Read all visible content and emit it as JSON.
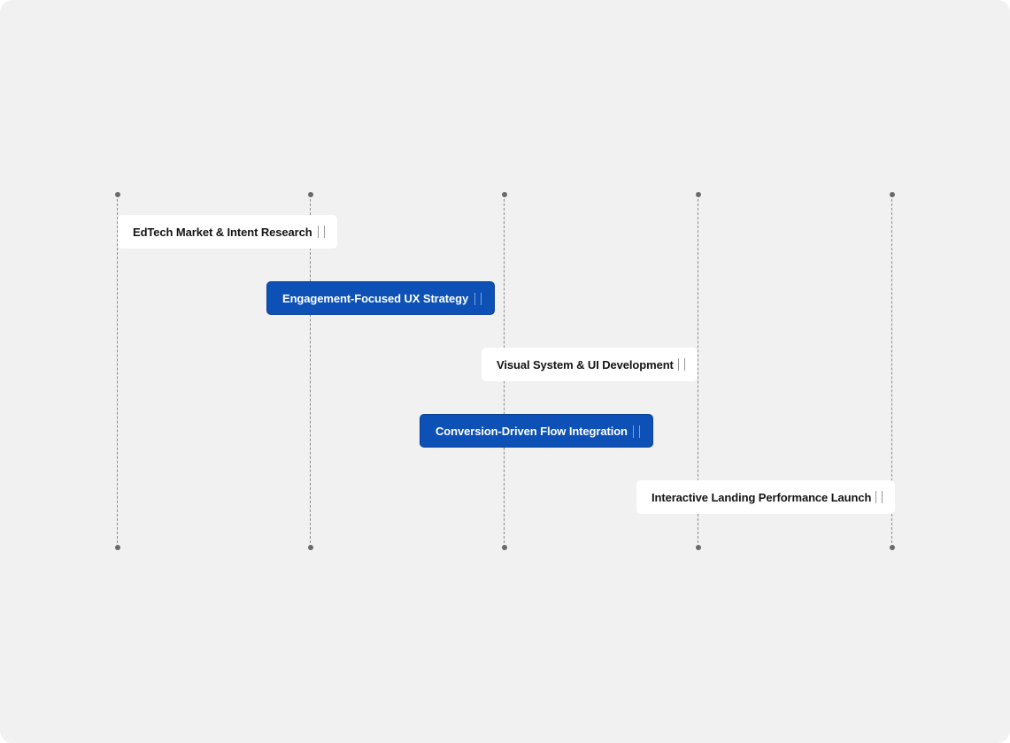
{
  "diagram": {
    "stages": [
      {
        "label": "EdTech Market & Intent Research",
        "style": "white",
        "drag_icon": "drag-handle-icon"
      },
      {
        "label": "Engagement-Focused UX Strategy",
        "style": "blue",
        "drag_icon": "drag-handle-icon"
      },
      {
        "label": "Visual System & UI Development",
        "style": "white",
        "drag_icon": "drag-handle-icon"
      },
      {
        "label": "Conversion-Driven Flow Integration",
        "style": "blue",
        "drag_icon": "drag-handle-icon"
      },
      {
        "label": "Interactive Landing Performance Launch",
        "style": "white",
        "drag_icon": "drag-handle-icon"
      }
    ],
    "colors": {
      "background": "#f1f1f1",
      "chip_white": "#ffffff",
      "chip_blue": "#0d51b7",
      "track": "#8c8c8c"
    }
  }
}
